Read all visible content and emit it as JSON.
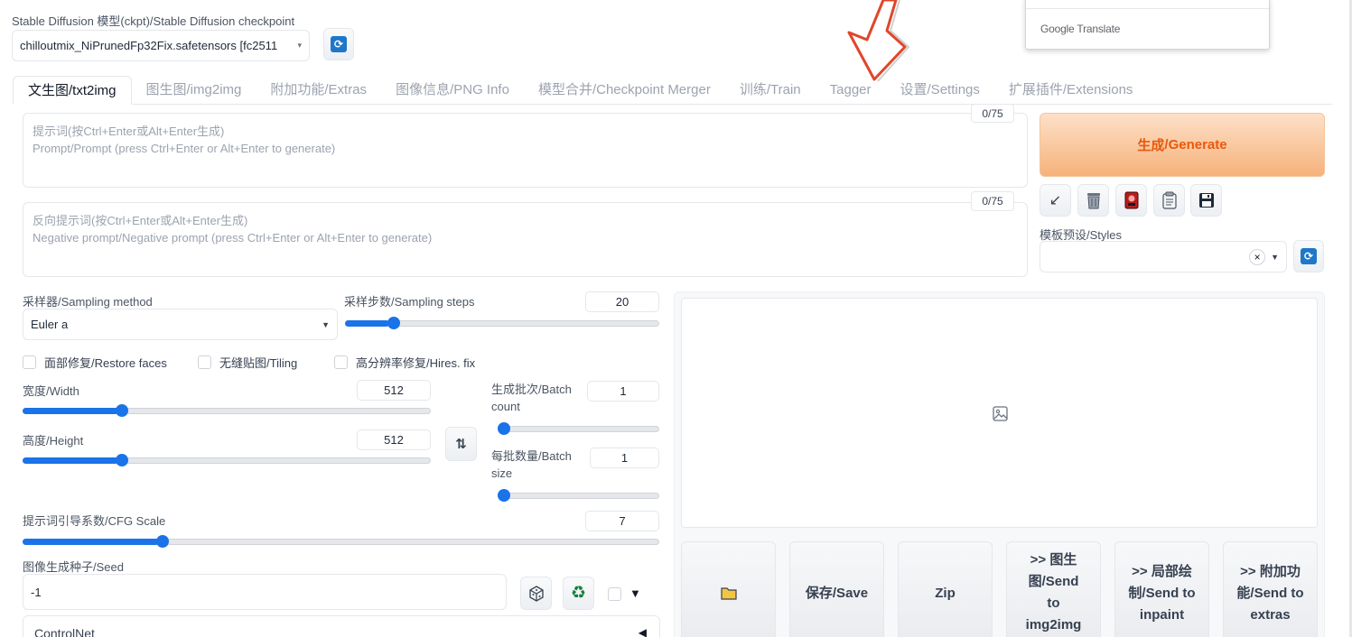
{
  "checkpoint": {
    "label": "Stable Diffusion 模型(ckpt)/Stable Diffusion checkpoint",
    "value": "chilloutmix_NiPrunedFp32Fix.safetensors [fc2511"
  },
  "translate_popup": {
    "label": "Google Translate"
  },
  "tabs": [
    {
      "label": "文生图/txt2img"
    },
    {
      "label": "图生图/img2img"
    },
    {
      "label": "附加功能/Extras"
    },
    {
      "label": "图像信息/PNG Info"
    },
    {
      "label": "模型合并/Checkpoint Merger"
    },
    {
      "label": "训练/Train"
    },
    {
      "label": "Tagger"
    },
    {
      "label": "设置/Settings"
    },
    {
      "label": "扩展插件/Extensions"
    }
  ],
  "prompt": {
    "placeholder_1": "提示词(按Ctrl+Enter或Alt+Enter生成)",
    "placeholder_2": "Prompt/Prompt (press Ctrl+Enter or Alt+Enter to generate)",
    "token_count": "0/75"
  },
  "negative_prompt": {
    "placeholder_1": "反向提示词(按Ctrl+Enter或Alt+Enter生成)",
    "placeholder_2": "Negative prompt/Negative prompt (press Ctrl+Enter or Alt+Enter to generate)",
    "token_count": "0/75"
  },
  "generate": {
    "label_cn": "生成",
    "label_en": "/Generate",
    "accent_color": "#f6b27a"
  },
  "styles": {
    "label": "模板预设/Styles",
    "clear_glyph": "×"
  },
  "sampling_method": {
    "label": "采样器/Sampling method",
    "value": "Euler a"
  },
  "sampling_steps": {
    "label": "采样步数/Sampling steps",
    "value": "20",
    "fraction": 0.14
  },
  "checkboxes": {
    "restore_faces": "面部修复/Restore faces",
    "tiling": "无缝贴图/Tiling",
    "hires_fix": "高分辨率修复/Hires. fix"
  },
  "width": {
    "label": "宽度/Width",
    "value": "512",
    "fraction": 0.235
  },
  "height": {
    "label": "高度/Height",
    "value": "512",
    "fraction": 0.235
  },
  "batch_count": {
    "label": "生成批次/Batch count",
    "value": "1",
    "fraction": 0.0
  },
  "batch_size": {
    "label": "每批数量/Batch size",
    "value": "1",
    "fraction": 0.0
  },
  "cfg_scale": {
    "label": "提示词引导系数/CFG Scale",
    "value": "7",
    "fraction": 0.214
  },
  "seed": {
    "label": "图像生成种子/Seed",
    "value": "-1",
    "extra_glyph": "▼"
  },
  "controlnet": {
    "label": "ControlNet",
    "collapse_glyph": "◀"
  },
  "output_actions": {
    "save": "保存/Save",
    "zip": "Zip",
    "send_img2img": ">> 图生图/Send to img2img",
    "send_inpaint": ">> 局部绘制/Send to inpaint",
    "send_extras": ">> 附加功能/Send to extras"
  },
  "accent_color": "#1a73e8"
}
